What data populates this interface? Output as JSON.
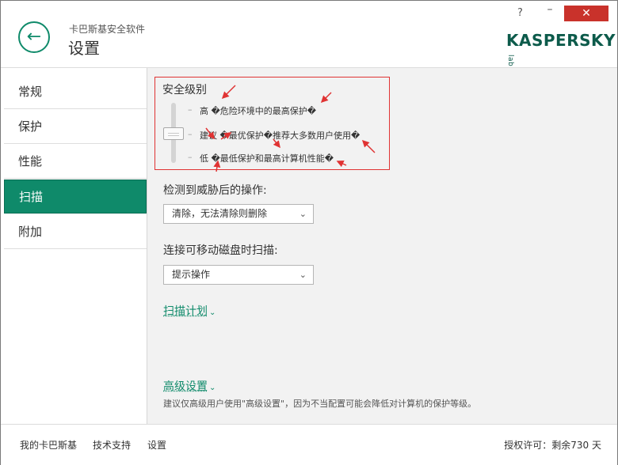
{
  "header": {
    "app_name": "卡巴斯基安全软件",
    "title": "设置",
    "help": "?",
    "minimize": "–",
    "close": "✕",
    "logo_main": "KASPERSKY",
    "logo_lab": "lab",
    "back_icon": "arrow-left-icon"
  },
  "sidebar": {
    "items": [
      {
        "label": "常规"
      },
      {
        "label": "保护"
      },
      {
        "label": "性能"
      },
      {
        "label": "扫描",
        "active": true
      },
      {
        "label": "附加"
      }
    ]
  },
  "security": {
    "title": "安全级别",
    "slider_level": "建议",
    "levels": [
      {
        "label": "高 �危险环境中的最高保护�"
      },
      {
        "label": "建议 �最优保护�推荐大多数用户使用�"
      },
      {
        "label": "低 �最低保护和最高计算机性能�"
      }
    ]
  },
  "threat_action": {
    "label": "检测到威胁后的操作:",
    "value": "清除，无法清除则删除"
  },
  "removable": {
    "label": "连接可移动磁盘时扫描:",
    "value": "提示操作"
  },
  "scan_schedule": {
    "label": "扫描计划"
  },
  "advanced": {
    "label": "高级设置",
    "hint": "建议仅高级用户使用\"高级设置\"，因为不当配置可能会降低对计算机的保护等级。"
  },
  "footer": {
    "my_kaspersky": "我的卡巴斯基",
    "support": "技术支持",
    "settings": "设置",
    "license": "授权许可：剩余730 天"
  },
  "colors": {
    "accent": "#0f8a6a",
    "annotation": "#e03333",
    "close": "#c9322b"
  }
}
